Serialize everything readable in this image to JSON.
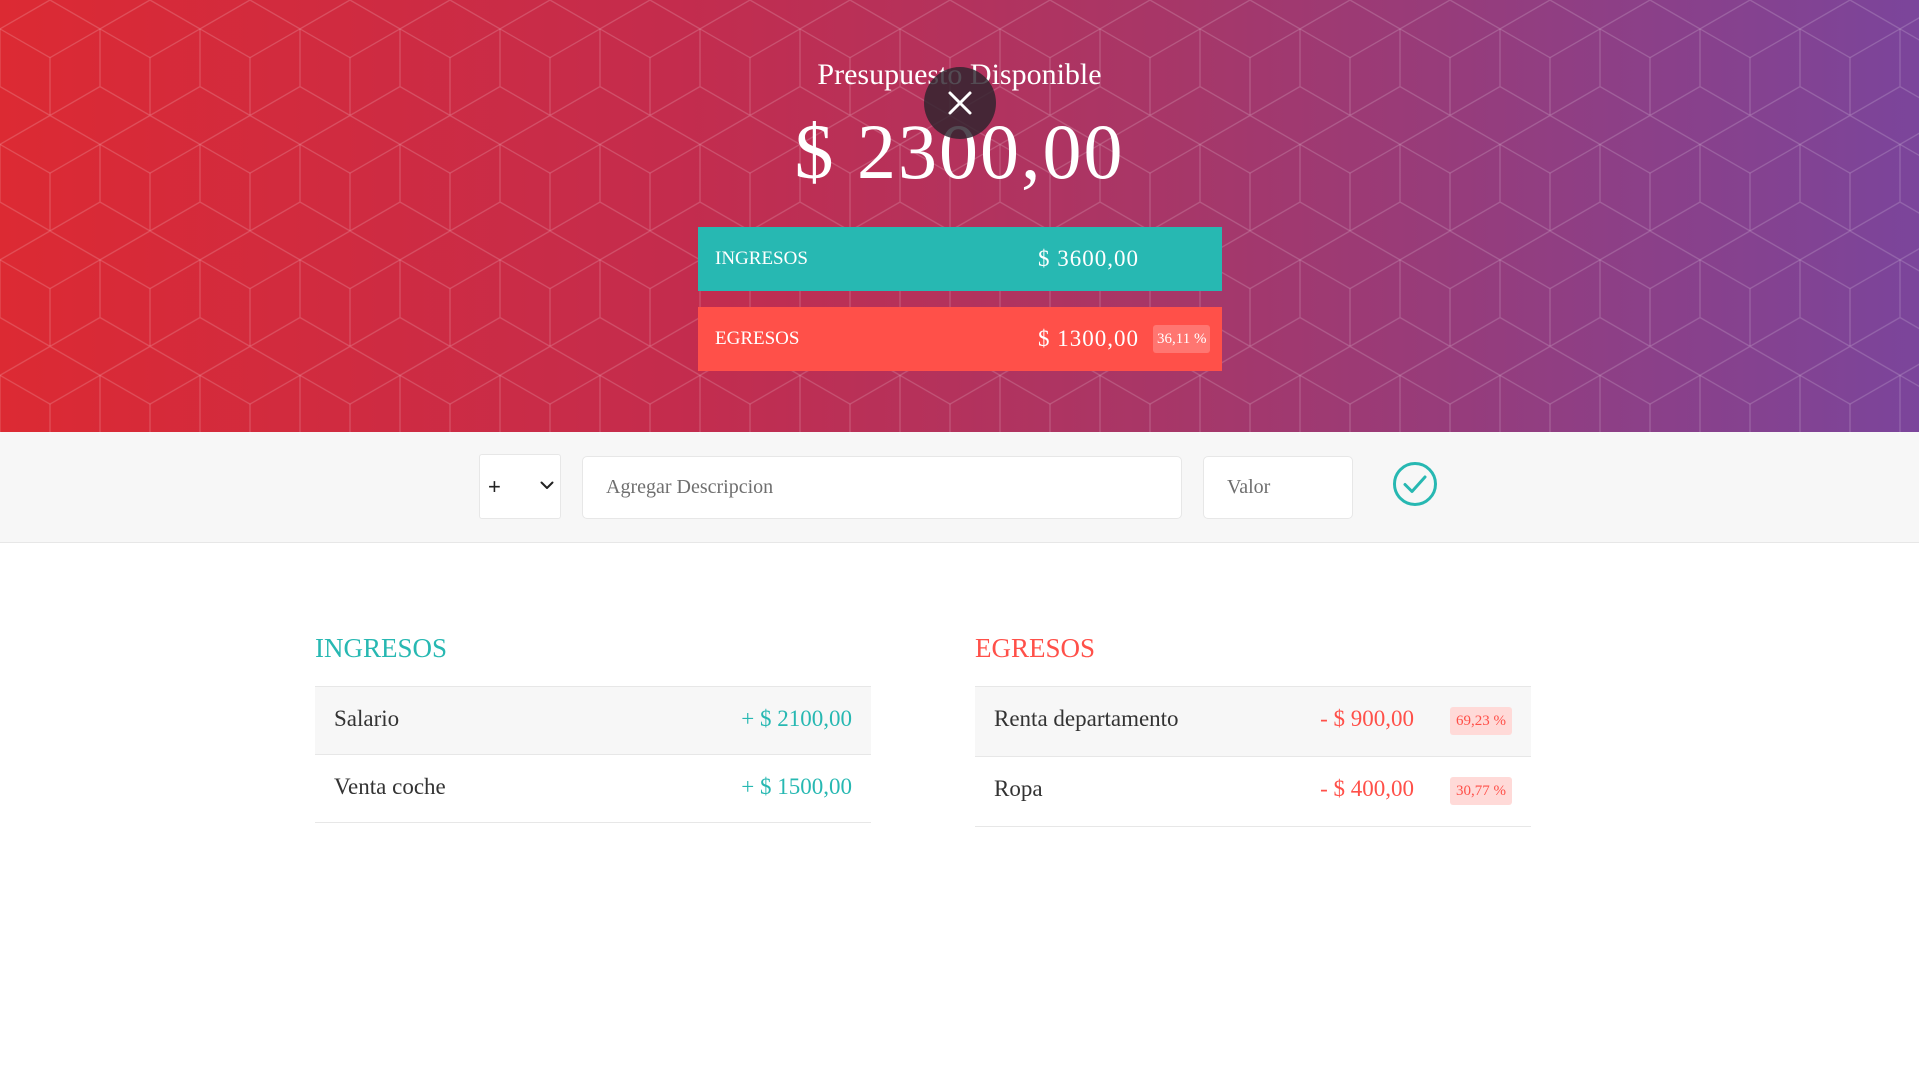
{
  "header": {
    "title": "Presupuesto Disponible",
    "budget": "$ 2300,00",
    "income_label": "INGRESOS",
    "income_total": "$ 3600,00",
    "expense_label": "EGRESOS",
    "expense_total": "$ 1300,00",
    "expense_percentage": "36,11 %",
    "close_icon": "close-icon"
  },
  "add_form": {
    "type_selected": "+",
    "type_options": [
      "+",
      "-"
    ],
    "description_placeholder": "Agregar Descripcion",
    "value_placeholder": "Valor",
    "submit_icon": "check-circle-icon"
  },
  "income": {
    "title": "INGRESOS",
    "items": [
      {
        "description": "Salario",
        "value": "+ $ 2100,00"
      },
      {
        "description": "Venta coche",
        "value": "+ $ 1500,00"
      }
    ]
  },
  "expenses": {
    "title": "EGRESOS",
    "items": [
      {
        "description": "Renta departamento",
        "value": "- $ 900,00",
        "percentage": "69,23 %"
      },
      {
        "description": "Ropa",
        "value": "- $ 400,00",
        "percentage": "30,77 %"
      }
    ]
  },
  "colors": {
    "income": "#27b8b2",
    "expense": "#ff5049",
    "gradient_start": "#dc2a33",
    "gradient_end": "#7b459b"
  }
}
